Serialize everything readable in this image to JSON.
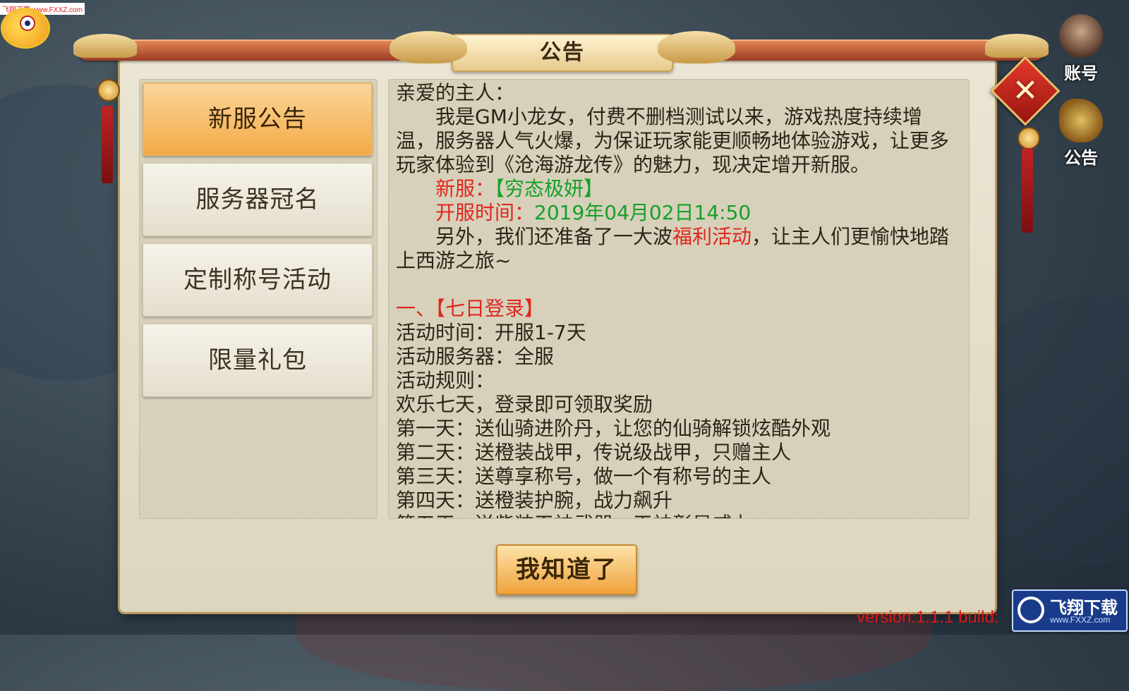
{
  "watermark_top": "飞翔下载 www.FXXZ.com",
  "side": {
    "account_label": "账号",
    "notice_label": "公告"
  },
  "dialog": {
    "title": "公告",
    "tabs": [
      "新服公告",
      "服务器冠名",
      "定制称号活动",
      "限量礼包"
    ],
    "active_tab": 0,
    "content": {
      "greeting": "亲爱的主人：",
      "intro": "我是GM小龙女，付费不删档测试以来，游戏热度持续增温，服务器人气火爆，为保证玩家能更顺畅地体验游戏，让更多玩家体验到《沧海游龙传》的魅力，现决定增开新服。",
      "new_server_label": "新服：",
      "new_server_name": "【穷态极妍】",
      "open_time_label": "开服时间：",
      "open_time_value": "2019年04月02日14:50",
      "extra_pre": "另外，我们还准备了一大波",
      "extra_highlight": "福利活动",
      "extra_post": "，让主人们更愉快地踏上西游之旅~",
      "section1_title": "一、【七日登录】",
      "lines": [
        "活动时间：开服1-7天",
        "活动服务器：全服",
        "活动规则：",
        "欢乐七天，登录即可领取奖励",
        "第一天：送仙骑进阶丹，让您的仙骑解锁炫酷外观",
        "第二天：送橙装战甲，传说级战甲，只赠主人",
        "第三天：送尊享称号，做一个有称号的主人",
        "第四天：送橙装护腕，战力飙升",
        "第五天：送紫装天神武器，天神彰显威力"
      ]
    },
    "ok_button": "我知道了"
  },
  "version_text": "version:1.1.1 build:",
  "watermark_br": {
    "title": "飞翔下载",
    "url": "www.FXXZ.com"
  },
  "colors": {
    "accent_red": "#e0261e",
    "accent_green": "#16a028",
    "tab_active": "#f3a944"
  }
}
